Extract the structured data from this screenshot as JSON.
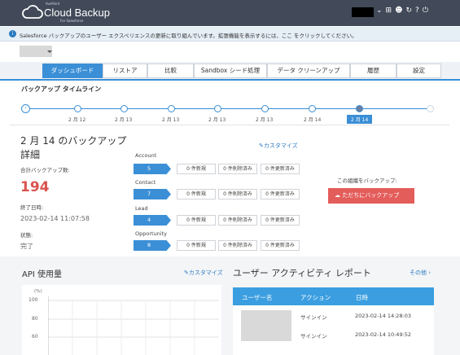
{
  "header": {
    "brand_small": "AvePoint",
    "brand_main": "Cloud Backup",
    "brand_sub": "For Salesforce",
    "icons": [
      "caret-down-icon",
      "grid-icon",
      "smiley-icon",
      "support-icon",
      "help-icon",
      "power-icon"
    ]
  },
  "notice": {
    "icon": "info-icon",
    "text": "Salesforce バックアップのユーザー エクスペリエンスの更新に取り組んでいます。拡張機能を表示するには、ここ をクリックしてください。"
  },
  "tabs": [
    {
      "label": "ダッシュボード",
      "active": true
    },
    {
      "label": "リストア",
      "active": false
    },
    {
      "label": "比較",
      "active": false
    },
    {
      "label": "Sandbox シード処理",
      "active": false
    },
    {
      "label": "データ クリーンアップ",
      "active": false
    },
    {
      "label": "履歴",
      "active": false
    },
    {
      "label": "設定",
      "active": false
    }
  ],
  "timeline": {
    "title": "バックアップ タイムライン",
    "dates": [
      "2 月 12",
      "2 月 13",
      "2 月 13",
      "2 月 13",
      "2 月 13",
      "2 月 14",
      "2 月 14"
    ],
    "active_index": 6
  },
  "details": {
    "title_line1": "2 月 14 のバックアップ",
    "title_line2": "詳細",
    "count_label": "合計バックアップ数:",
    "count_value": "194",
    "end_time_label": "終了日時:",
    "end_time_value": "2023-02-14 11:07:58",
    "status_label": "状態:",
    "status_value": "完了",
    "customize_label": "カスタマイズ"
  },
  "objects": [
    {
      "name": "Account",
      "count": "5",
      "new": "0 件新規",
      "deleted": "0 件削除済み",
      "updated": "0 件更新済み"
    },
    {
      "name": "Contact",
      "count": "7",
      "new": "0 件新規",
      "deleted": "0 件削除済み",
      "updated": "0 件更新済み"
    },
    {
      "name": "Lead",
      "count": "4",
      "new": "0 件新規",
      "deleted": "0 件削除済み",
      "updated": "0 件更新済み"
    },
    {
      "name": "Opportunity",
      "count": "8",
      "new": "0 件新規",
      "deleted": "0 件削除済み",
      "updated": "0 件更新済み"
    }
  ],
  "backup_action": {
    "label": "この組織をバックアップ:",
    "button": "ただちにバックアップ"
  },
  "api": {
    "title": "API 使用量",
    "customize_label": "カスタマイズ",
    "unit": "(%)",
    "ticks": [
      "100",
      "80",
      "60"
    ]
  },
  "activity": {
    "title": "ユーザー アクティビティ レポート",
    "more": "その他",
    "columns": [
      "ユーザー名",
      "アクション",
      "日時"
    ],
    "rows": [
      {
        "action": "サインイン",
        "datetime": "2023-02-14 14:28:03"
      },
      {
        "action": "サインイン",
        "datetime": "2023-02-14 10:49:52"
      }
    ]
  },
  "colors": {
    "accent": "#3b8fd6",
    "topbar": "#424a59",
    "danger": "#e35d5b"
  }
}
